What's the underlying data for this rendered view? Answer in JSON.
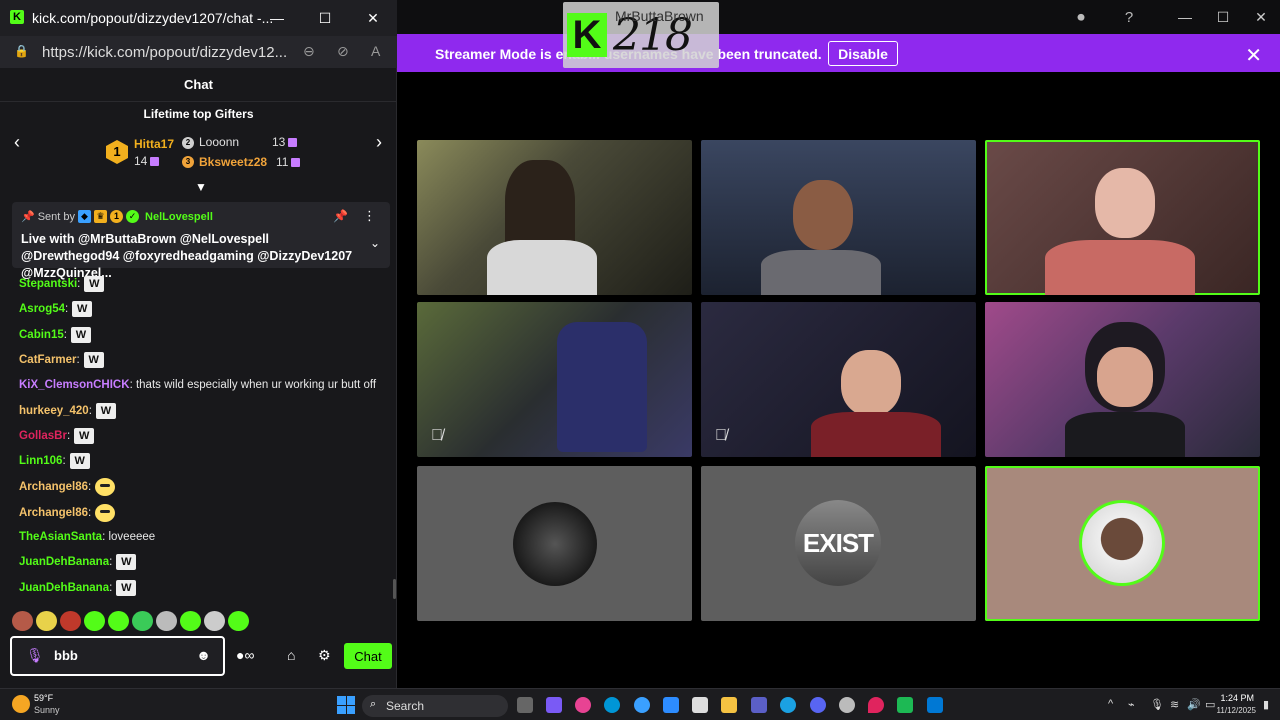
{
  "browser": {
    "title": "kick.com/popout/dizzydev1207/chat -...",
    "url": "https://kick.com/popout/dizzydev12...",
    "favicon": "K"
  },
  "chat": {
    "header": "Chat",
    "gifters": {
      "title": "Lifetime top Gifters",
      "items": [
        {
          "rank": "1",
          "name": "Hitta17",
          "count": "14",
          "color": "#f2b01e"
        },
        {
          "rank": "2",
          "name": "Looonn",
          "count": "13",
          "color": "#cfcfcf"
        },
        {
          "rank": "3",
          "name": "Bksweetz28",
          "count": "11",
          "color": "#f0a33a"
        }
      ]
    },
    "pinned": {
      "sent_by": "Sent by",
      "user": "NelLovespell",
      "message": "Live with @MrButtaBrown @NelLovespell @Drewthegod94 @foxyredheadgaming @DizzyDev1207 @MzzQuinzel..."
    },
    "messages": [
      {
        "user": "Stepantski",
        "color": "#53fc18",
        "text": "",
        "emote": "W"
      },
      {
        "user": "Asrog54",
        "color": "#53fc18",
        "text": "",
        "emote": "W"
      },
      {
        "user": "Cabin15",
        "color": "#53fc18",
        "text": "",
        "emote": "W"
      },
      {
        "user": "CatFarmer",
        "color": "#f4c26b",
        "text": "",
        "emote": "W"
      },
      {
        "user": "KiX_ClemsonCHICK",
        "color": "#c77dff",
        "text": " thats wild especially when ur working ur butt off",
        "emote": ""
      },
      {
        "user": "hurkeey_420",
        "color": "#f4c26b",
        "text": "",
        "emote": "W"
      },
      {
        "user": "GollasBr",
        "color": "#e0245e",
        "text": "",
        "emote": "W"
      },
      {
        "user": "Linn106",
        "color": "#53fc18",
        "text": "",
        "emote": "W"
      },
      {
        "user": "Archangel86",
        "color": "#f4c26b",
        "text": "",
        "emote": "bee"
      },
      {
        "user": "Archangel86",
        "color": "#f4c26b",
        "text": "",
        "emote": "bee"
      },
      {
        "user": "TheAsianSanta",
        "color": "#53fc18",
        "text": " loveeeee",
        "emote": ""
      },
      {
        "user": "JuanDehBanana",
        "color": "#53fc18",
        "text": "",
        "emote": "W"
      },
      {
        "user": "JuanDehBanana",
        "color": "#53fc18",
        "text": "",
        "emote": "W"
      }
    ],
    "input": {
      "value": "bbb"
    },
    "send_label": "Chat"
  },
  "stream": {
    "overlay_number": "218",
    "overlay_name": "MrButtaBrown",
    "banner": {
      "text": "Streamer Mode is enab... usernames have been truncated.",
      "button": "Disable"
    },
    "tiles": [
      {
        "bg": "#3a3a28",
        "active": false,
        "muted": false
      },
      {
        "bg": "#2f3a4a",
        "active": false,
        "muted": false
      },
      {
        "bg": "#5a3a40",
        "active": true,
        "muted": false
      },
      {
        "bg": "#2b3340",
        "active": false,
        "muted": true
      },
      {
        "bg": "#2a2036",
        "active": false,
        "muted": true
      },
      {
        "bg": "#5a3a66",
        "active": false,
        "muted": false
      },
      {
        "bg": "#5a5a5a",
        "active": false,
        "muted": false,
        "avatar": "dark-avatar"
      },
      {
        "bg": "#5a5a5a",
        "active": false,
        "muted": false,
        "avatar": "EXIST"
      },
      {
        "bg": "#a8897c",
        "active": true,
        "muted": false,
        "avatar": "photo"
      }
    ]
  },
  "taskbar": {
    "weather_temp": "59°F",
    "weather_cond": "Sunny",
    "search_placeholder": "Search",
    "time": "1:24 PM",
    "date": "11/12/2025"
  }
}
